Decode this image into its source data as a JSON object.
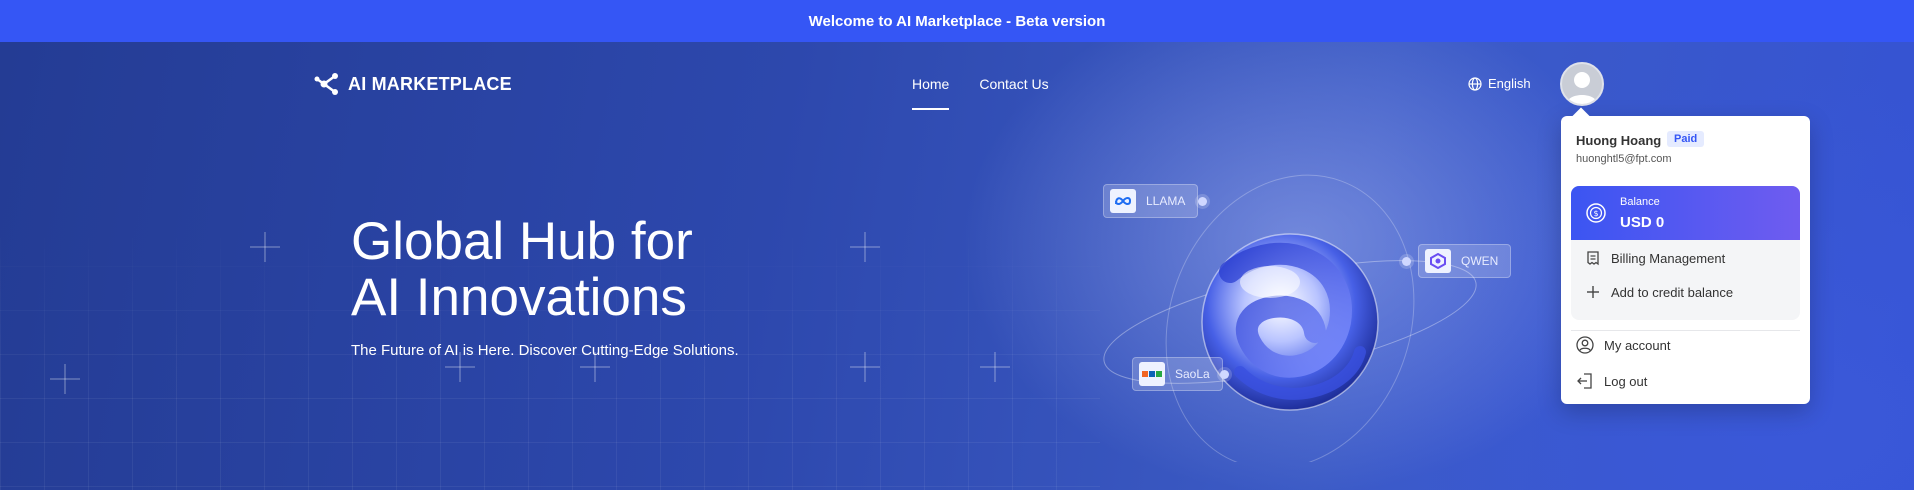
{
  "banner": {
    "text": "Welcome to AI Marketplace - Beta version"
  },
  "nav": {
    "logo_text": "AI MARKETPLACE",
    "links": [
      {
        "label": "Home",
        "active": true
      },
      {
        "label": "Contact Us",
        "active": false
      }
    ],
    "language": "English",
    "avatar_icon": "user-avatar-icon"
  },
  "hero": {
    "title_line1": "Global Hub for",
    "title_line2": "AI Innovations",
    "subtitle": "The Future of AI is Here. Discover Cutting-Edge Solutions.",
    "models": [
      {
        "label": "LLAMA",
        "icon": "meta-logo-icon"
      },
      {
        "label": "QWEN",
        "icon": "qwen-logo-icon"
      },
      {
        "label": "SaoLa",
        "icon": "fpt-logo-icon"
      }
    ]
  },
  "account_menu": {
    "user_name": "Huong Hoang",
    "plan_badge": "Paid",
    "email": "huonghtl5@fpt.com",
    "balance_label": "Balance",
    "balance_value": "USD 0",
    "billing_label": "Billing Management",
    "add_credit_label": "Add to credit balance",
    "my_account_label": "My account",
    "logout_label": "Log out"
  },
  "colors": {
    "banner": "#3556f5",
    "hero_dark": "#243c94",
    "accent": "#3b55f2",
    "accent_purple": "#6f5cf0"
  }
}
